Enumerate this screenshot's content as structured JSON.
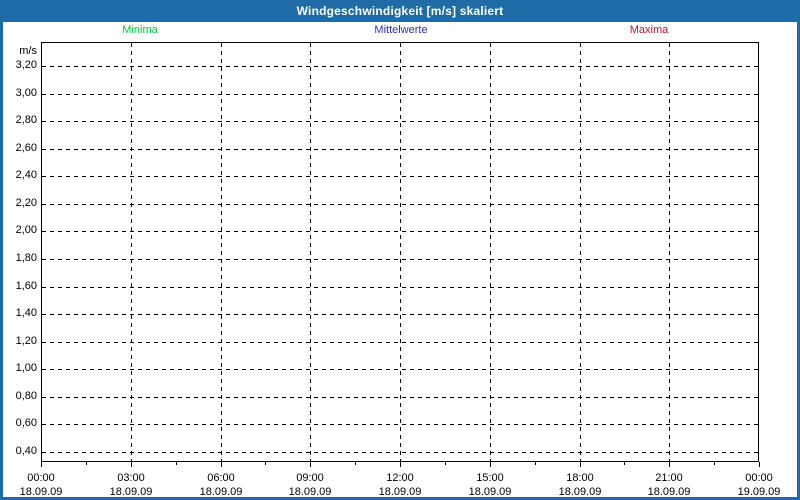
{
  "window": {
    "title": "Windgeschwindigkeit [m/s] skaliert"
  },
  "colors": {
    "frame": "#1f6ba6",
    "title_text": "#ffffff",
    "background": "#ffffff",
    "grid": "#000000",
    "text": "#000000"
  },
  "legend": {
    "items": [
      {
        "label": "Minima",
        "color": "#00cc33"
      },
      {
        "label": "Mittelwerte",
        "color": "#2a2acd"
      },
      {
        "label": "Maxima",
        "color": "#c40e32"
      }
    ]
  },
  "chart_data": {
    "type": "line",
    "title": "Windgeschwindigkeit [m/s] skaliert",
    "ylabel": "m/s",
    "xlabel": "",
    "grid": "dashed",
    "legend_position": "top",
    "y_ticks": [
      "3,20",
      "3,00",
      "2,80",
      "2,60",
      "2,40",
      "2,20",
      "2,00",
      "1,80",
      "1,60",
      "1,40",
      "1,20",
      "1,00",
      "0,80",
      "0,60",
      "0,40"
    ],
    "ylim": [
      0.32,
      3.37
    ],
    "y_step": 0.2,
    "x_ticks": [
      {
        "time": "00:00",
        "date": "18.09.09"
      },
      {
        "time": "03:00",
        "date": "18.09.09"
      },
      {
        "time": "06:00",
        "date": "18.09.09"
      },
      {
        "time": "09:00",
        "date": "18.09.09"
      },
      {
        "time": "12:00",
        "date": "18.09.09"
      },
      {
        "time": "15:00",
        "date": "18.09.09"
      },
      {
        "time": "18:00",
        "date": "18.09.09"
      },
      {
        "time": "21:00",
        "date": "18.09.09"
      },
      {
        "time": "00:00",
        "date": "19.09.09"
      }
    ],
    "series": [
      {
        "name": "Minima",
        "color": "#00cc33",
        "values": []
      },
      {
        "name": "Mittelwerte",
        "color": "#2a2acd",
        "values": []
      },
      {
        "name": "Maxima",
        "color": "#c40e32",
        "values": []
      }
    ]
  }
}
